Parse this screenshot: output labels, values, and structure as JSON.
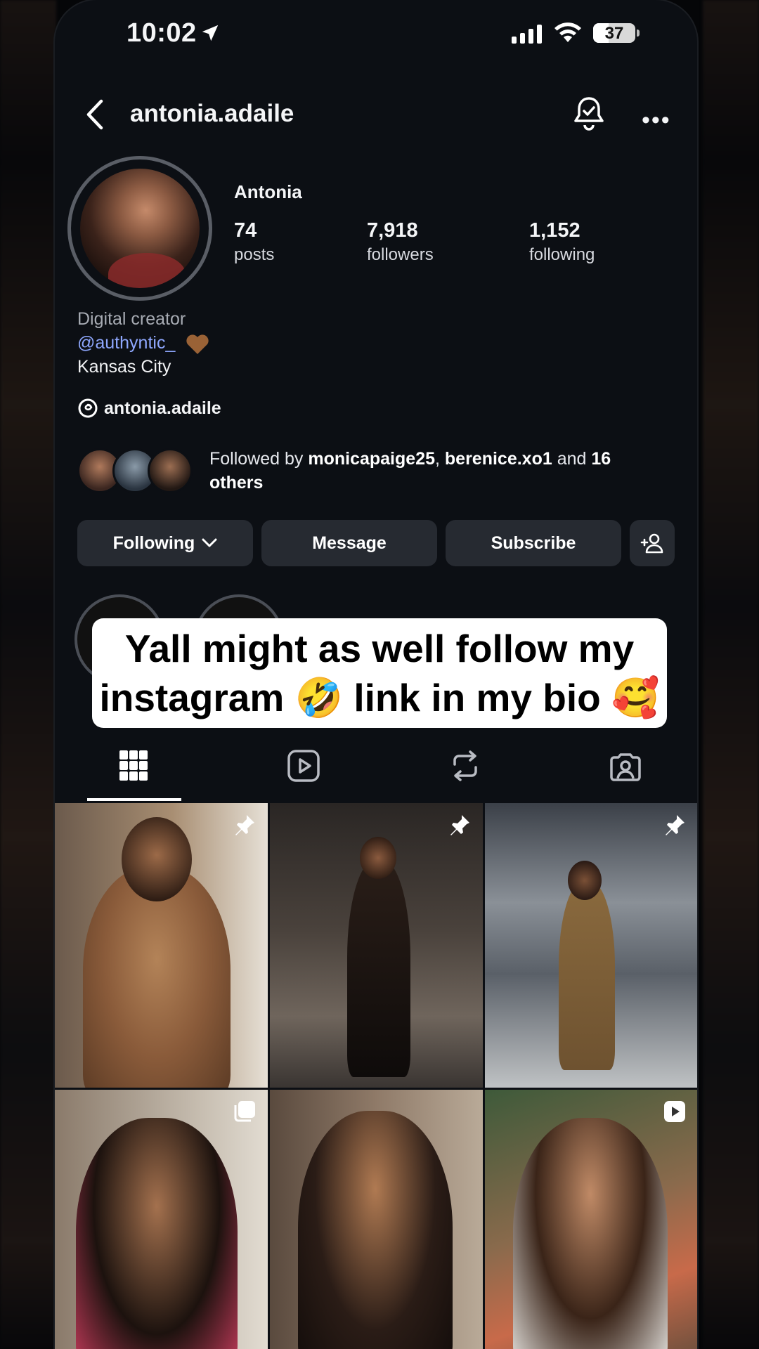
{
  "status_bar": {
    "time": "10:02",
    "battery": "37",
    "battery_level": 0.37
  },
  "header": {
    "username": "antonia.adaile"
  },
  "profile": {
    "display_name": "Antonia",
    "stats": [
      {
        "value": "74",
        "label": "posts"
      },
      {
        "value": "7,918",
        "label": "followers"
      },
      {
        "value": "1,152",
        "label": "following"
      }
    ],
    "bio_category": "Digital creator",
    "bio_link": "@authyntic_",
    "bio_location": "Kansas City",
    "threads_handle": "antonia.adaile",
    "followed_by": {
      "prefix": "Followed by ",
      "user1": "monicapaige25",
      "sep": ", ",
      "user2": "berenice.xo1",
      "and": " and ",
      "count": "16",
      "suffix": "others"
    }
  },
  "buttons": {
    "following": "Following",
    "message": "Message",
    "subscribe": "Subscribe"
  },
  "caption": {
    "line1": "Yall might as well follow my",
    "line2": "instagram 🤣 link in my bio 🥰"
  },
  "tabs": [
    "posts-grid",
    "reels",
    "reposts",
    "tagged"
  ],
  "icons": [
    "back-icon",
    "bell-check-icon",
    "more-icon",
    "threads-icon",
    "add-person-icon",
    "pin-icon",
    "carousel-icon",
    "reel-icon"
  ],
  "colors": {
    "background": "#0c0f14",
    "button": "#262a31",
    "link": "#8fa8ff"
  }
}
